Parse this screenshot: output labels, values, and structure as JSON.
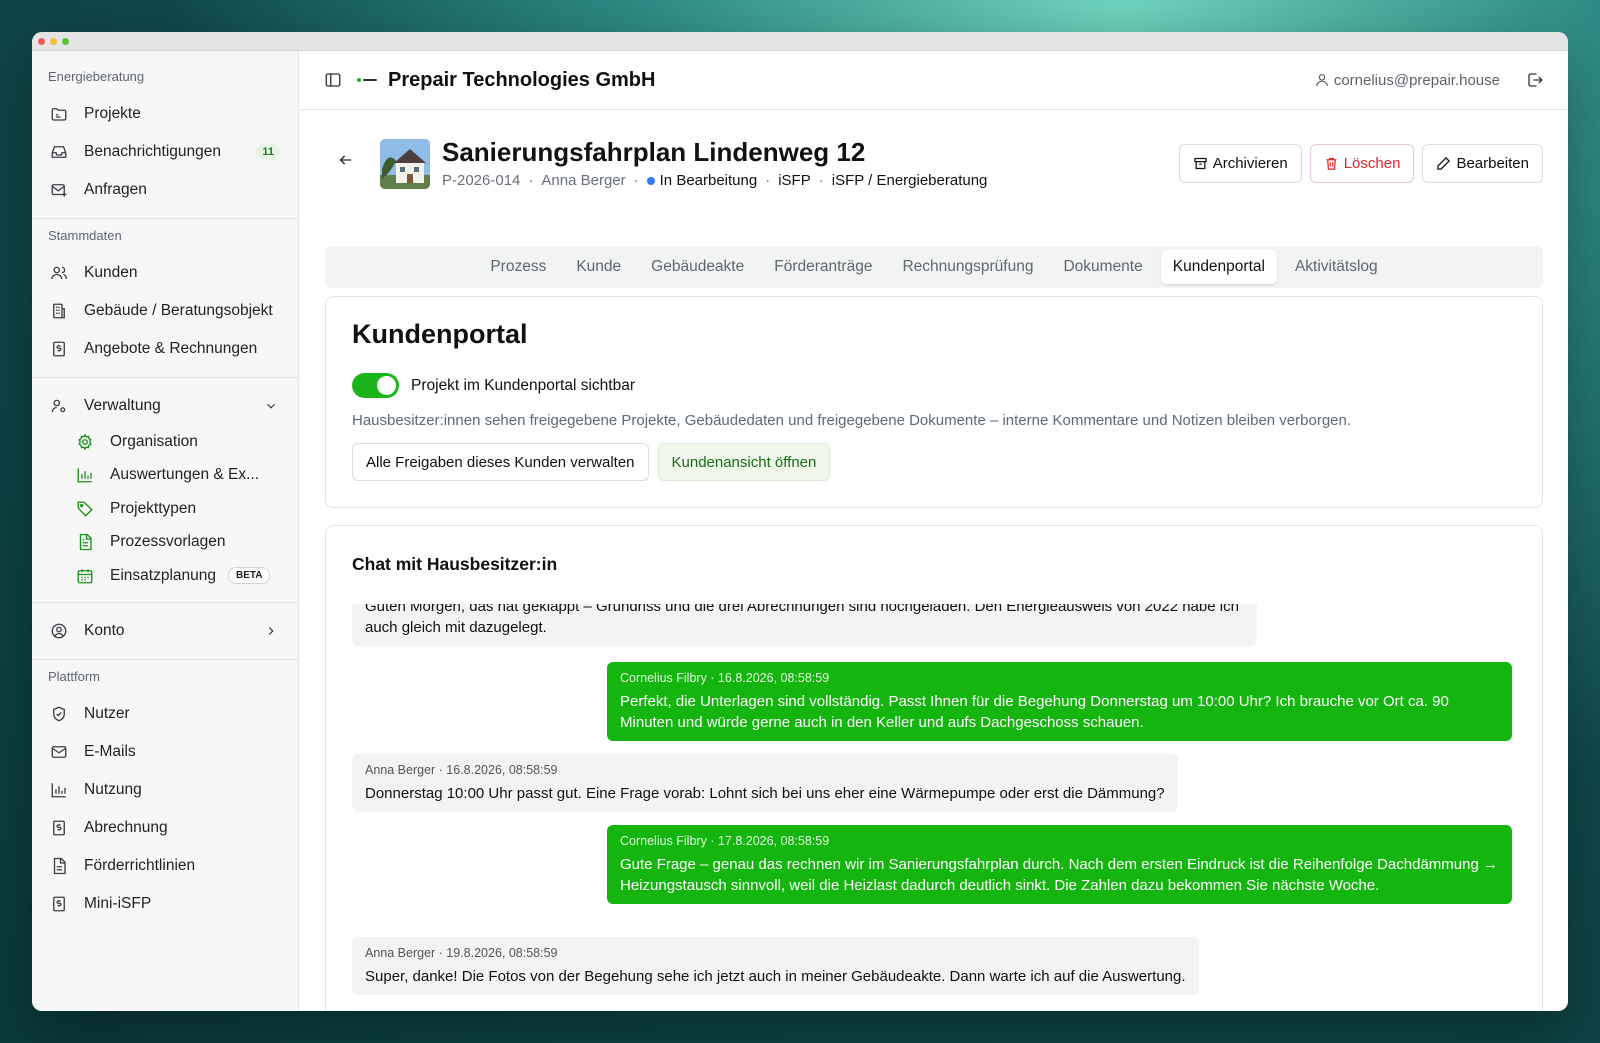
{
  "sidebar": {
    "sections": {
      "energieberatung": "Energieberatung",
      "stammdaten": "Stammdaten",
      "plattform": "Plattform"
    },
    "items": {
      "projekte": "Projekte",
      "benachrichtigungen": "Benachrichtigungen",
      "benachrichtigungen_count": "11",
      "anfragen": "Anfragen",
      "kunden": "Kunden",
      "gebaeude": "Gebäude / Beratungsobjekt",
      "angebote": "Angebote & Rechnungen",
      "verwaltung": "Verwaltung",
      "organisation": "Organisation",
      "auswertungen": "Auswertungen & Ex...",
      "projekttypen": "Projekttypen",
      "prozessvorlagen": "Prozessvorlagen",
      "einsatzplanung": "Einsatzplanung",
      "beta": "BETA",
      "konto": "Konto",
      "nutzer": "Nutzer",
      "emails": "E-Mails",
      "nutzung": "Nutzung",
      "abrechnung": "Abrechnung",
      "foerderrichtlinien": "Förderrichtlinien",
      "mini_isfp": "Mini-iSFP"
    }
  },
  "topbar": {
    "company": "Prepair Technologies GmbH",
    "user": "cornelius@prepair.house"
  },
  "project": {
    "title": "Sanierungsfahrplan Lindenweg 12",
    "id": "P-2026-014",
    "client": "Anna Berger",
    "status": "In Bearbeitung",
    "type": "iSFP",
    "category": "iSFP / Energieberatung",
    "sep": "·"
  },
  "actions": {
    "archive": "Archivieren",
    "delete": "Löschen",
    "edit": "Bearbeiten"
  },
  "tabs": [
    "Prozess",
    "Kunde",
    "Gebäudeakte",
    "Förderanträge",
    "Rechnungsprüfung",
    "Dokumente",
    "Kundenportal",
    "Aktivitätslog"
  ],
  "active_tab": "Kundenportal",
  "portal": {
    "heading": "Kundenportal",
    "toggle_label": "Projekt im Kundenportal sichtbar",
    "toggle_on": true,
    "info": "Hausbesitzer:innen sehen freigegebene Projekte, Gebäudedaten und freigegebene Dokumente – interne Kommentare und Notizen bleiben verborgen.",
    "btn_manage": "Alle Freigaben dieses Kunden verwalten",
    "btn_open": "Kundenansicht öffnen"
  },
  "chat": {
    "title": "Chat mit Hausbesitzer:in",
    "messages": [
      {
        "sender": "",
        "text": "Guten Morgen, das hat geklappt – Grundriss und die drei Abrechnungen sind hochgeladen. Den Energieausweis von 2022 habe ich auch gleich mit dazugelegt."
      },
      {
        "sender": "Cornelius Filbry · 16.8.2026, 08:58:59",
        "text": "Perfekt, die Unterlagen sind vollständig. Passt Ihnen für die Begehung Donnerstag um 10:00 Uhr? Ich brauche vor Ort ca. 90 Minuten und würde gerne auch in den Keller und aufs Dachgeschoss schauen."
      },
      {
        "sender": "Anna Berger · 16.8.2026, 08:58:59",
        "text": "Donnerstag 10:00 Uhr passt gut. Eine Frage vorab: Lohnt sich bei uns eher eine Wärmepumpe oder erst die Dämmung?"
      },
      {
        "sender": "Cornelius Filbry · 17.8.2026, 08:58:59",
        "text": "Gute Frage – genau das rechnen wir im Sanierungsfahrplan durch. Nach dem ersten Eindruck ist die Reihenfolge Dachdämmung → Heizungstausch sinnvoll, weil die Heizlast dadurch deutlich sinkt. Die Zahlen dazu bekommen Sie nächste Woche."
      },
      {
        "sender": "Anna Berger · 19.8.2026, 08:58:59",
        "text": "Super, danke! Die Fotos von der Begehung sehe ich jetzt auch in meiner Gebäudeakte. Dann warte ich auf die Auswertung."
      }
    ]
  },
  "colors": {
    "accent_green": "#15b50f",
    "danger": "#dc2b2b",
    "status_blue": "#2f7bf0"
  }
}
